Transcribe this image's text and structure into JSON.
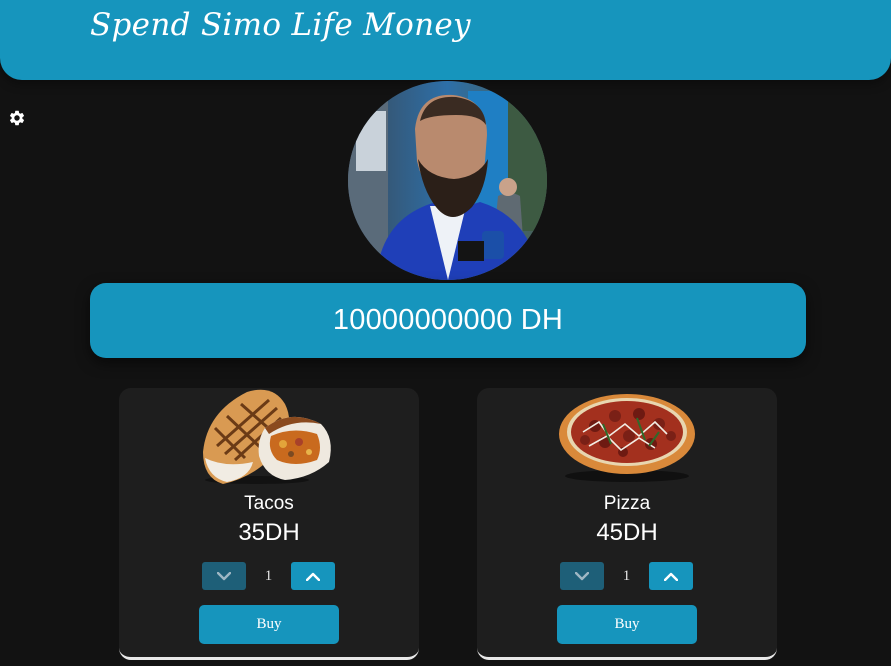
{
  "header": {
    "title": "Spend Simo Life Money"
  },
  "settings": {
    "icon": "gear-icon"
  },
  "profile": {
    "avatar": "avatar"
  },
  "balance": {
    "text": "10000000000 DH"
  },
  "products": [
    {
      "name": "Tacos",
      "price": "35DH",
      "quantity": "1",
      "buy_label": "Buy",
      "image": "tacos-image"
    },
    {
      "name": "Pizza",
      "price": "45DH",
      "quantity": "1",
      "buy_label": "Buy",
      "image": "pizza-image"
    }
  ],
  "colors": {
    "accent": "#1695bd",
    "accent_dark": "#1e5f78",
    "background": "#121212",
    "card": "#1e1e1e"
  }
}
